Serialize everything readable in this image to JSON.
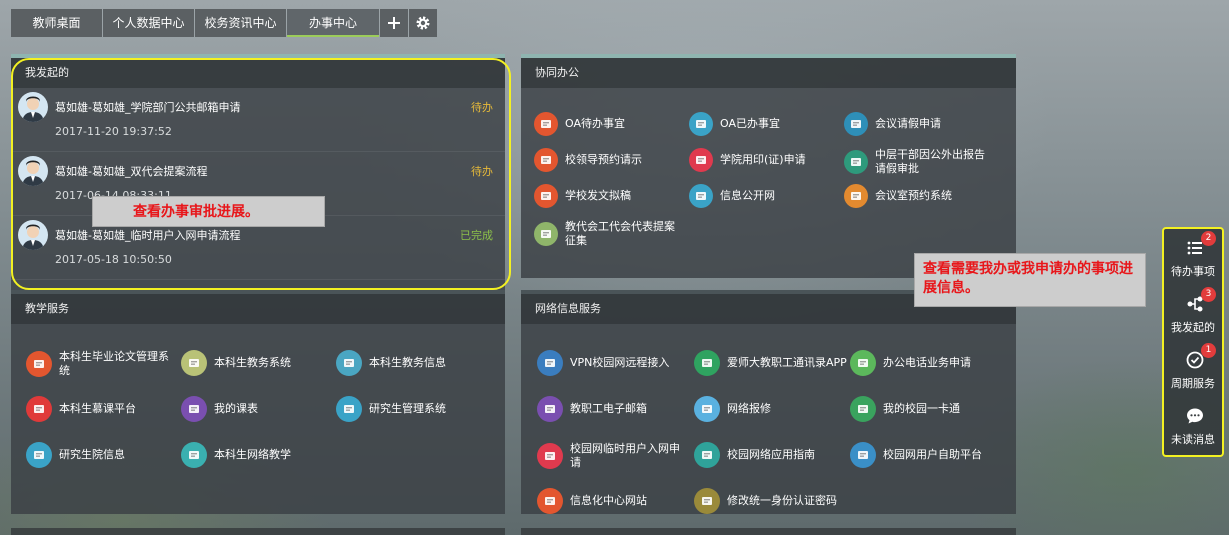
{
  "nav": {
    "tabs": [
      {
        "label": "教师桌面"
      },
      {
        "label": "个人数据中心"
      },
      {
        "label": "校务资讯中心"
      },
      {
        "label": "办事中心"
      }
    ],
    "active_tab": "办事中心"
  },
  "my_initiated": {
    "title": "我发起的",
    "items": [
      {
        "title": "葛如雄-葛如雄_学院部门公共邮箱申请",
        "time": "2017-11-20 19:37:52",
        "status": "待办",
        "status_color": "#e5b93a"
      },
      {
        "title": "葛如雄-葛如雄_双代会提案流程",
        "time": "2017-06-14 08:33:11",
        "status": "待办",
        "status_color": "#e5b93a"
      },
      {
        "title": "葛如雄-葛如雄_临时用户入网申请流程",
        "time": "2017-05-18 10:50:50",
        "status": "已完成",
        "status_color": "#8cc04a"
      }
    ]
  },
  "collab": {
    "title": "协同办公",
    "items": [
      {
        "label": "OA待办事宜",
        "color": "#e3562f"
      },
      {
        "label": "OA已办事宜",
        "color": "#3aa3c7"
      },
      {
        "label": "会议请假申请",
        "color": "#2e8fb8"
      },
      {
        "label": "校领导预约请示",
        "color": "#e3562f"
      },
      {
        "label": "学院用印(证)申请",
        "color": "#e03a4e"
      },
      {
        "label": "中层干部因公外出报告请假审批",
        "color": "#2e9a7c"
      },
      {
        "label": "学校发文拟稿",
        "color": "#e3562f"
      },
      {
        "label": "信息公开网",
        "color": "#3aa3c7"
      },
      {
        "label": "会议室预约系统",
        "color": "#e38a2f"
      },
      {
        "label": "教代会工代会代表提案征集",
        "color": "#8fb56a"
      }
    ]
  },
  "teaching": {
    "title": "教学服务",
    "items": [
      {
        "label": "本科生毕业论文管理系统",
        "color": "#e3562f"
      },
      {
        "label": "本科生教务系统",
        "color": "#b9c277"
      },
      {
        "label": "本科生教务信息",
        "color": "#4aa6c2"
      },
      {
        "label": "本科生慕课平台",
        "color": "#e03a3a"
      },
      {
        "label": "我的课表",
        "color": "#7a4fb0"
      },
      {
        "label": "研究生管理系统",
        "color": "#3aa3c7"
      },
      {
        "label": "研究生院信息",
        "color": "#3aa3c7"
      },
      {
        "label": "本科生网络教学",
        "color": "#3ab0b0"
      }
    ]
  },
  "network": {
    "title": "网络信息服务",
    "items": [
      {
        "label": "VPN校园网远程接入",
        "color": "#3a7dbf"
      },
      {
        "label": "爱师大教职工通讯录APP",
        "color": "#2fa360"
      },
      {
        "label": "办公电话业务申请",
        "color": "#5cb85c"
      },
      {
        "label": "教职工电子邮箱",
        "color": "#7a4fb0"
      },
      {
        "label": "网络报修",
        "color": "#5ab1e0"
      },
      {
        "label": "我的校园一卡通",
        "color": "#3aa35e"
      },
      {
        "label": "校园网临时用户入网申请",
        "color": "#e03a4e"
      },
      {
        "label": "校园网络应用指南",
        "color": "#2fa39a"
      },
      {
        "label": "校园网用户自助平台",
        "color": "#3a8fc7"
      },
      {
        "label": "信息化中心网站",
        "color": "#e3562f"
      },
      {
        "label": "修改统一身份认证密码",
        "color": "#9a8a3a"
      }
    ]
  },
  "annotations": {
    "note1": "查看办事审批进展。",
    "note2": "查看需要我办或我申请办的事项进展信息。"
  },
  "sidebar": {
    "items": [
      {
        "label": "待办事项",
        "badge": "2",
        "icon": "list-icon"
      },
      {
        "label": "我发起的",
        "badge": "3",
        "icon": "flow-icon"
      },
      {
        "label": "周期服务",
        "badge": "1",
        "icon": "clock-check-icon"
      },
      {
        "label": "未读消息",
        "badge": "",
        "icon": "chat-icon"
      }
    ]
  }
}
